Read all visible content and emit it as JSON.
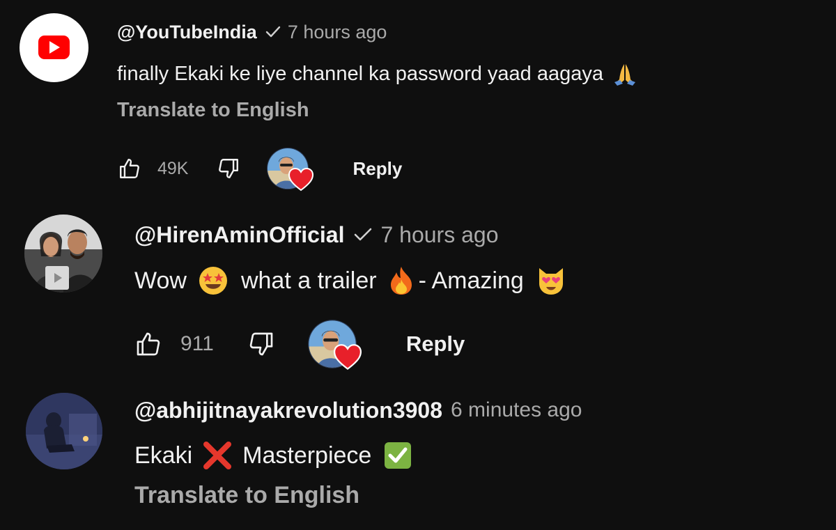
{
  "comments": [
    {
      "handle": "@YouTubeIndia",
      "verified": true,
      "time": "7 hours ago",
      "text_parts": [
        "finally Ekaki ke liye channel ka password yaad aagaya"
      ],
      "emoji_1": "praying-hands",
      "translate": "Translate to English",
      "likes": "49K",
      "reply": "Reply",
      "avatar_icon": "youtube-logo-icon"
    },
    {
      "handle": "@HirenAminOfficial",
      "verified": true,
      "time": "7 hours ago",
      "text_a": "Wow",
      "text_b": "what a trailer",
      "text_c": "- Amazing",
      "likes": "911",
      "reply": "Reply"
    },
    {
      "handle": "@abhijitnayakrevolution3908",
      "verified": false,
      "time": "6 minutes ago",
      "text_a": "Ekaki",
      "text_b": "Masterpiece",
      "translate": "Translate to English"
    }
  ],
  "colors": {
    "background": "#0f0f0f",
    "text_primary": "#f1f1f1",
    "text_secondary": "#aaaaaa",
    "youtube_red": "#ff0000",
    "heart_red": "#e8202a"
  }
}
